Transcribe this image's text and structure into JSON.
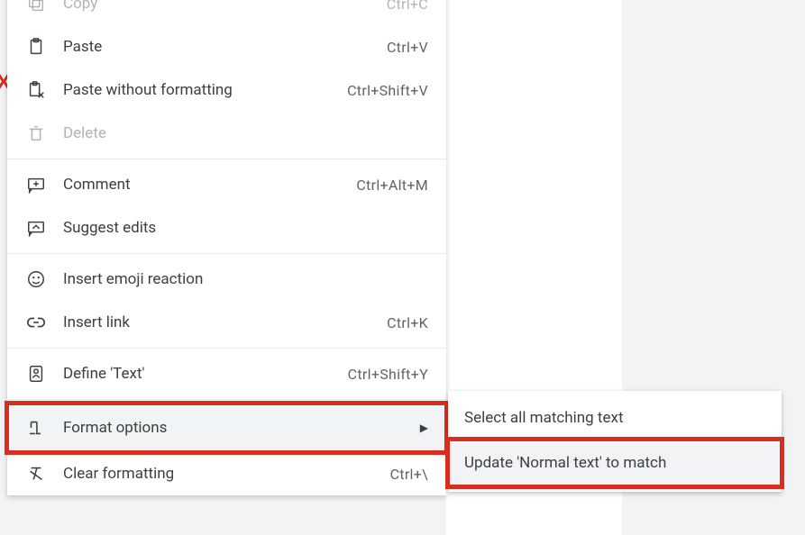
{
  "menu": {
    "copy": {
      "label": "Copy",
      "shortcut": "Ctrl+C"
    },
    "paste": {
      "label": "Paste",
      "shortcut": "Ctrl+V"
    },
    "paste_plain": {
      "label": "Paste without formatting",
      "shortcut": "Ctrl+Shift+V"
    },
    "delete": {
      "label": "Delete"
    },
    "comment": {
      "label": "Comment",
      "shortcut": "Ctrl+Alt+M"
    },
    "suggest": {
      "label": "Suggest edits"
    },
    "emoji": {
      "label": "Insert emoji reaction"
    },
    "link": {
      "label": "Insert link",
      "shortcut": "Ctrl+K"
    },
    "define": {
      "label": "Define 'Text'",
      "shortcut": "Ctrl+Shift+Y"
    },
    "format_options": {
      "label": "Format options"
    },
    "clear_format": {
      "label": "Clear formatting",
      "shortcut": "Ctrl+\\"
    }
  },
  "submenu": {
    "select_matching": "Select all matching text",
    "update_normal": "Update 'Normal text' to match"
  }
}
